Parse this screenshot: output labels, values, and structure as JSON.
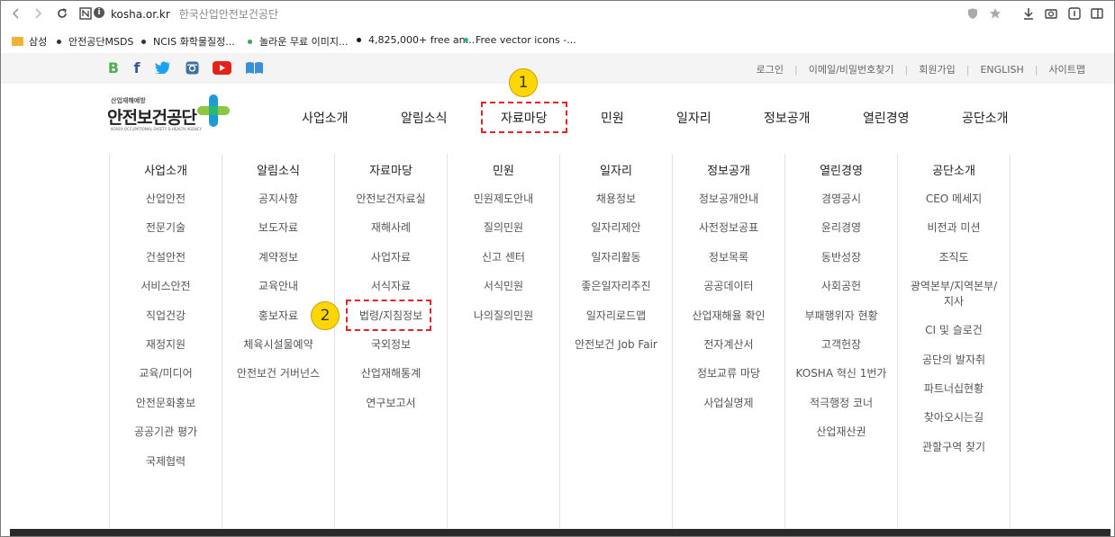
{
  "browser": {
    "url_host": "kosha.or.kr",
    "page_title": "한국산업안전보건공단"
  },
  "bookmarks": [
    {
      "label": "삼성",
      "icon": "folder-icon"
    },
    {
      "label": "안전공단MSDS",
      "icon": "dot"
    },
    {
      "label": "NCIS  화학물질정...",
      "icon": "dot"
    },
    {
      "label": "놀라운 무료 이미지...",
      "icon": "dot"
    },
    {
      "label": "4,825,000+ free an...",
      "icon": "dot"
    },
    {
      "label": "Free vector icons -...",
      "icon": "dot"
    }
  ],
  "social": [
    "B",
    "f",
    "twitter-icon",
    "instagram-icon",
    "youtube-icon",
    "book-icon"
  ],
  "util_links": [
    "로그인",
    "이메일/비밀번호찾기",
    "회원가입",
    "ENGLISH",
    "사이트맵"
  ],
  "logo": {
    "small": "산업재해예방",
    "big": "안전보건공단",
    "eng": "KOREA OCCUPATIONAL SAFETY & HEALTH AGENCY"
  },
  "nav": [
    "사업소개",
    "알림소식",
    "자료마당",
    "민원",
    "일자리",
    "정보공개",
    "열린경영",
    "공단소개"
  ],
  "menu": [
    {
      "head": "사업소개",
      "items": [
        "산업안전",
        "전문기술",
        "건설안전",
        "서비스안전",
        "직업건강",
        "재정지원",
        "교육/미디어",
        "안전문화홍보",
        "공공기관 평가",
        "국제협력"
      ]
    },
    {
      "head": "알림소식",
      "items": [
        "공지사항",
        "보도자료",
        "계약정보",
        "교육안내",
        "홍보자료",
        "체육시설물예약",
        "안전보건 거버넌스"
      ]
    },
    {
      "head": "자료마당",
      "items": [
        "안전보건자료실",
        "재해사례",
        "사업자료",
        "서식자료",
        "법령/지침정보",
        "국외정보",
        "산업재해통계",
        "연구보고서"
      ]
    },
    {
      "head": "민원",
      "items": [
        "민원제도안내",
        "질의민원",
        "신고 센터",
        "서식민원",
        "나의질의민원"
      ]
    },
    {
      "head": "일자리",
      "items": [
        "채용정보",
        "일자리제안",
        "일자리활동",
        "좋은일자리추진",
        "일자리로드맵",
        "안전보건 Job Fair"
      ]
    },
    {
      "head": "정보공개",
      "items": [
        "정보공개안내",
        "사전정보공표",
        "정보목록",
        "공공데이터",
        "산업재해율 확인",
        "전자계산서",
        "정보교류 마당",
        "사업실명제"
      ]
    },
    {
      "head": "열린경영",
      "items": [
        "경영공시",
        "윤리경영",
        "동반성장",
        "사회공헌",
        "부패행위자 현황",
        "고객헌장",
        "KOSHA 혁신 1번가",
        "적극행정 코너",
        "산업재산권"
      ]
    },
    {
      "head": "공단소개",
      "items": [
        "CEO 메세지",
        "비전과 미션",
        "조직도",
        "광역본부/지역본부/\n지사",
        "CI 및 슬로건",
        "공단의 발자취",
        "파트너십현황",
        "찾아오시는길",
        "관할구역 찾기"
      ]
    }
  ],
  "annotations": {
    "badge1": "1",
    "badge2": "2"
  },
  "colors": {
    "annotation": "#e0262a",
    "badge": "#ffd700",
    "logo_green": "#8dc63f",
    "logo_blue": "#1e9bd7"
  }
}
